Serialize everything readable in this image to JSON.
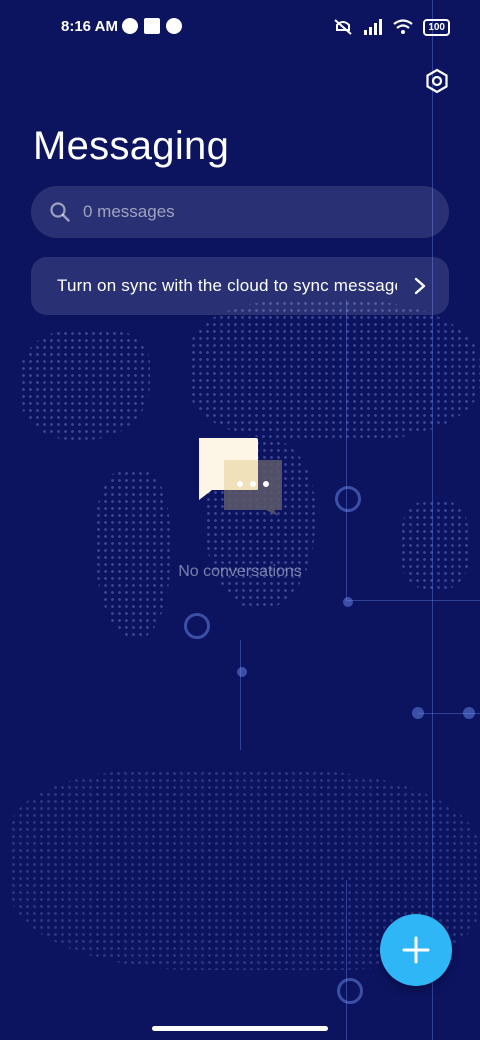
{
  "status_bar": {
    "time": "8:16 AM",
    "battery": "100"
  },
  "header": {
    "title": "Messaging"
  },
  "search": {
    "placeholder": "0 messages"
  },
  "sync_banner": {
    "text": "Turn on sync with the cloud to sync messages"
  },
  "empty_state": {
    "text": "No conversations"
  },
  "colors": {
    "background": "#0c1460",
    "fab": "#2fb6f7"
  }
}
